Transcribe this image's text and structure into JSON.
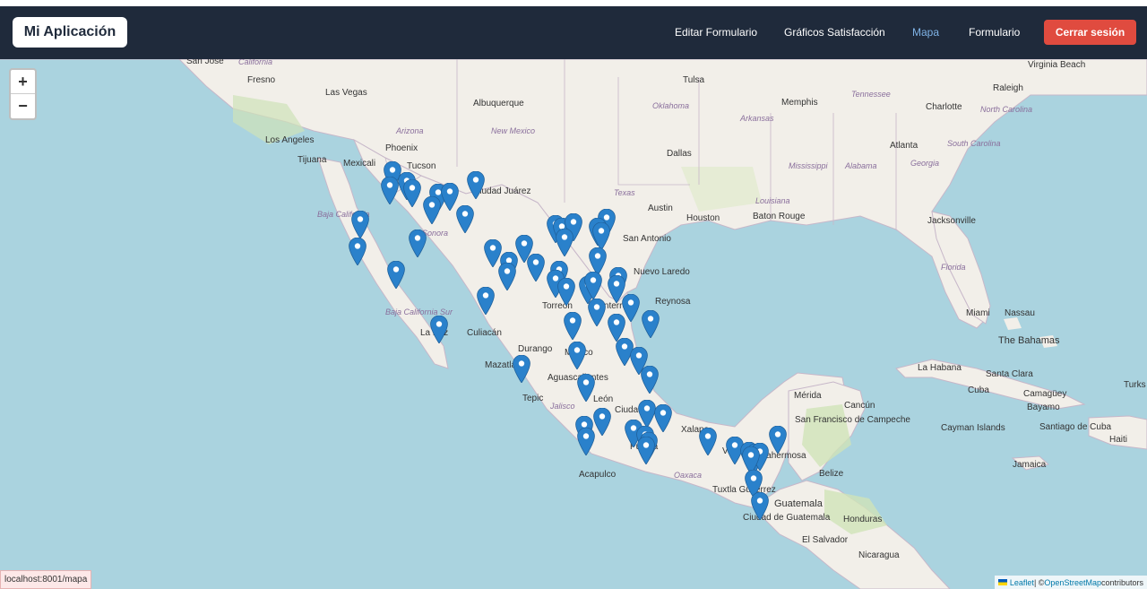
{
  "brand": "Mi Aplicación",
  "nav": {
    "links": [
      {
        "label": "Editar Formulario"
      },
      {
        "label": "Gráficos Satisfacción"
      },
      {
        "label": "Mapa"
      },
      {
        "label": "Formulario"
      }
    ],
    "logout": "Cerrar sesión"
  },
  "zoom": {
    "in": "+",
    "out": "−"
  },
  "attribution": {
    "leaflet": "Leaflet",
    "sep": " | © ",
    "osm": "OpenStreetMap",
    "suffix": " contributors"
  },
  "status_url": "localhost:8001/mapa",
  "map_labels": [
    "San Jose",
    "California",
    "Fresno",
    "Las Vegas",
    "Los Angeles",
    "Tijuana",
    "Mexicali",
    "Phoenix",
    "Tucson",
    "Arizona",
    "Albuquerque",
    "New Mexico",
    "Ciudad Juárez",
    "Tulsa",
    "Oklahoma",
    "Memphis",
    "Arkansas",
    "Tennessee",
    "Raleigh",
    "Virginia Beach",
    "North Carolina",
    "Charlotte",
    "Atlanta",
    "South Carolina",
    "Georgia",
    "Dallas",
    "Texas",
    "Austin",
    "Houston",
    "San Antonio",
    "Baton Rouge",
    "Louisiana",
    "Mississippi",
    "Alabama",
    "Jacksonville",
    "Florida",
    "Miami",
    "Nassau",
    "The Bahamas",
    "Baja California",
    "Baja California Sur",
    "Sonora",
    "La Paz",
    "Culiacán",
    "Durango",
    "Torreón",
    "Nuevo Laredo",
    "Reynosa",
    "Mazatlán",
    "Aguascalientes",
    "Tepic",
    "Jalisco",
    "León",
    "Ciudad",
    "Puebla",
    "Acapulco",
    "Oaxaca",
    "Xalapa",
    "Tuxtla Gutiérrez",
    "Guatemala",
    "Ciudad de Guatemala",
    "Honduras",
    "El Salvador",
    "Nicaragua",
    "Mérida",
    "Cancún",
    "San Francisco de Campeche",
    "Belize",
    "La Habana",
    "Cuba",
    "Santa Clara",
    "Camagüey",
    "Bayamo",
    "Santiago de Cuba",
    "Cayman Islands",
    "Jamaica",
    "Haiti",
    "Turks and Caicos Islands",
    "Monterrey",
    "México",
    "Veracruz",
    "Villahermosa"
  ],
  "colors": {
    "navbar": "#1f2a3b",
    "logout": "#e04b3f",
    "active_link": "#7fb3e6",
    "water": "#aad3df",
    "land": "#f2efe9",
    "marker": "#2a81cb"
  },
  "marker_count": 84
}
